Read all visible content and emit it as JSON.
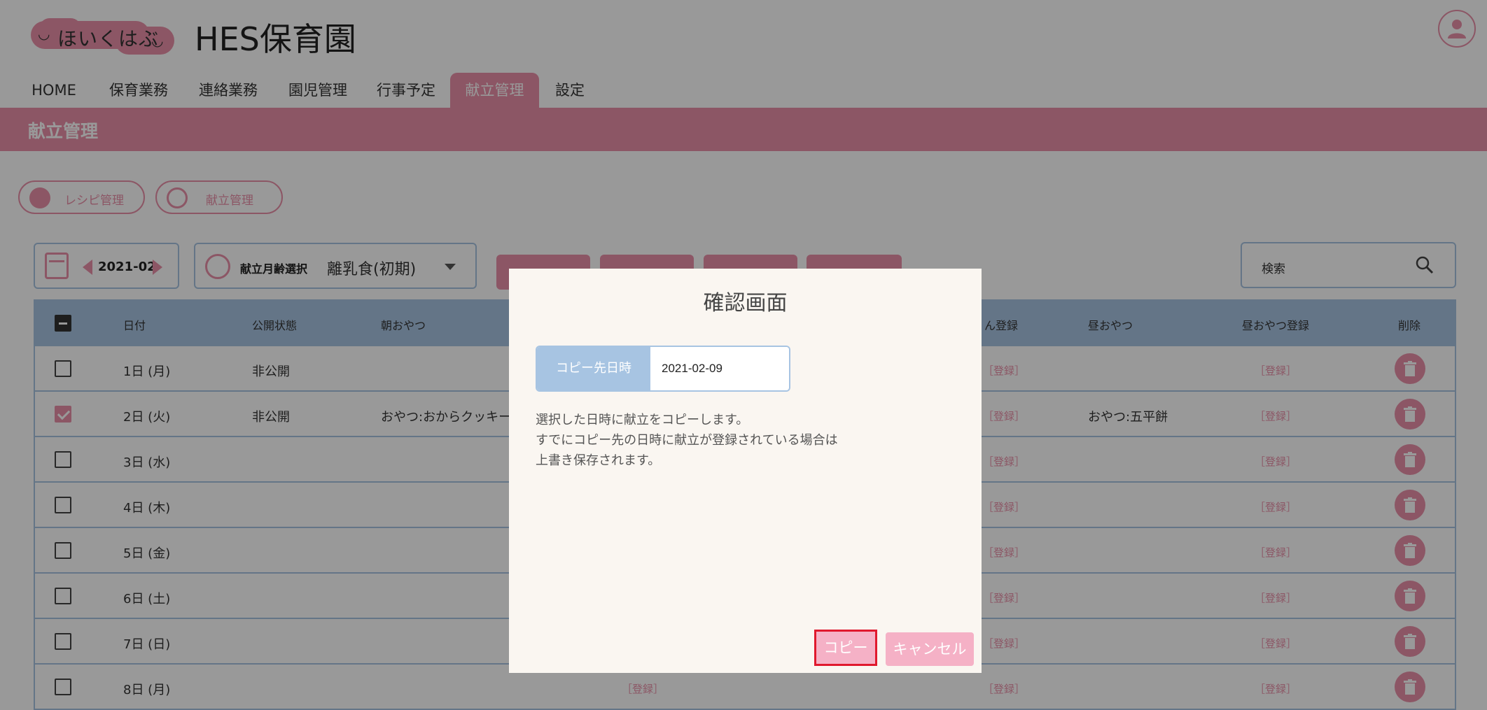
{
  "logo": {
    "text": "ほいくはぶ"
  },
  "site": {
    "title": "HES保育園"
  },
  "nav": {
    "items": [
      {
        "label": "HOME"
      },
      {
        "label": "保育業務"
      },
      {
        "label": "連絡業務"
      },
      {
        "label": "園児管理"
      },
      {
        "label": "行事予定"
      },
      {
        "label": "献立管理",
        "active": true
      },
      {
        "label": "設定"
      }
    ]
  },
  "page": {
    "title": "献立管理"
  },
  "subnav": {
    "recipe_label": "レシピ管理",
    "menu_label": "献立管理"
  },
  "toolbar": {
    "month": "2021-02",
    "age_label": "献立月齢選択",
    "age_value": "離乳食(初期)",
    "search_placeholder": "検索"
  },
  "table": {
    "headers": {
      "date": "日付",
      "status": "公開状態",
      "morning_snack": "朝おやつ",
      "lunch_register": "ん登録",
      "afternoon_snack": "昼おやつ",
      "afternoon_snack_register": "昼おやつ登録",
      "delete": "削除"
    },
    "register_label": "［登録］",
    "rows": [
      {
        "date": "1日 (月)",
        "status": "非公開",
        "morning": "",
        "afternoon": "",
        "checked": false
      },
      {
        "date": "2日 (火)",
        "status": "非公開",
        "morning": "おやつ:おからクッキー",
        "afternoon": "おやつ:五平餅",
        "checked": true
      },
      {
        "date": "3日 (水)",
        "status": "",
        "morning": "",
        "afternoon": "",
        "checked": false
      },
      {
        "date": "4日 (木)",
        "status": "",
        "morning": "",
        "afternoon": "",
        "checked": false
      },
      {
        "date": "5日 (金)",
        "status": "",
        "morning": "",
        "afternoon": "",
        "checked": false
      },
      {
        "date": "6日 (土)",
        "status": "",
        "morning": "",
        "afternoon": "",
        "checked": false
      },
      {
        "date": "7日 (日)",
        "status": "",
        "morning": "",
        "afternoon": "",
        "checked": false
      },
      {
        "date": "8日 (月)",
        "status": "",
        "morning": "",
        "afternoon": "",
        "checked": false
      }
    ]
  },
  "modal": {
    "title": "確認画面",
    "field_label": "コピー先日時",
    "field_value": "2021-02-09",
    "message_lines": [
      "選択した日時に献立をコピーします。",
      "すでにコピー先の日時に献立が登録されている場合は",
      "上書き保存されます。"
    ],
    "copy_label": "コピー",
    "cancel_label": "キャンセル"
  },
  "colors": {
    "accent": "#e990a8",
    "table_header": "#a7c4e2",
    "highlight": "#e0192e"
  }
}
